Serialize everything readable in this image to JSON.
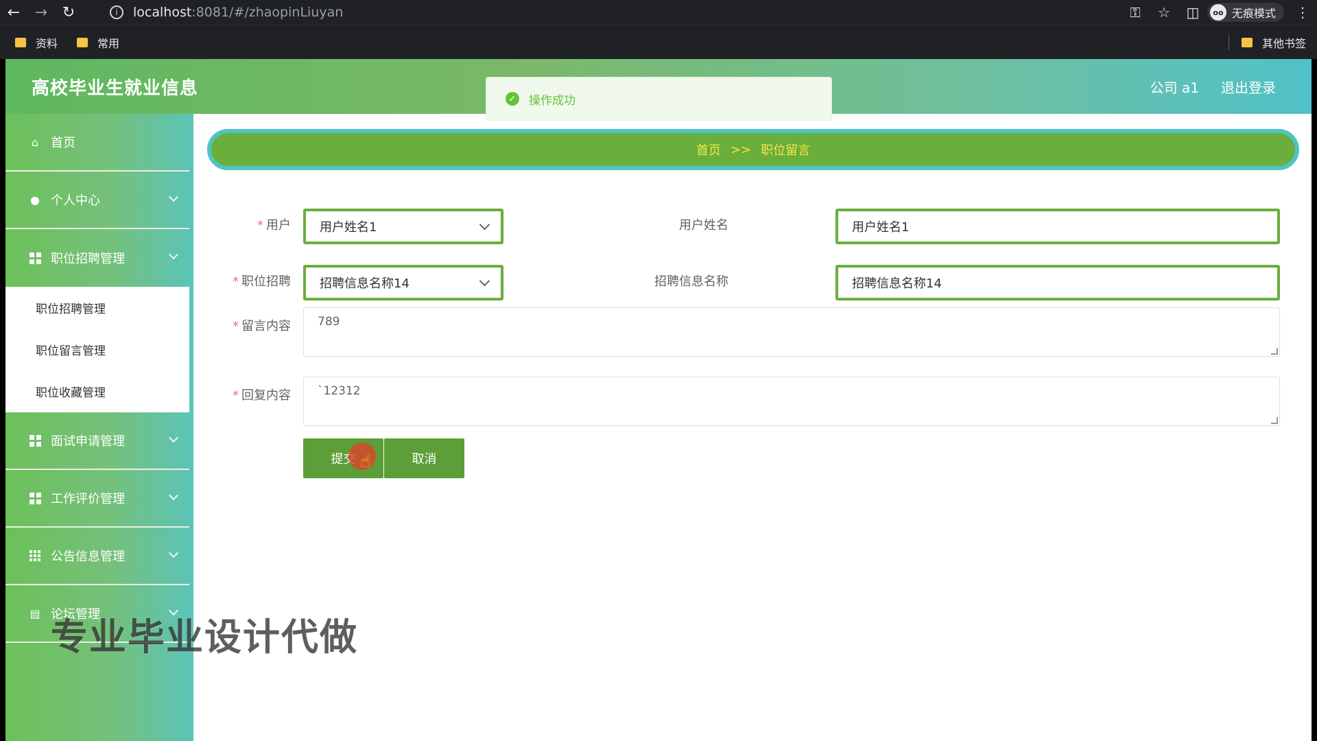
{
  "browser": {
    "url_host": "localhost",
    "url_rest": ":8081/#/zhaopinLiuyan",
    "incognito_label": "无痕模式",
    "bookmarks": [
      "资料",
      "常用"
    ],
    "other_bookmarks": "其他书签"
  },
  "header": {
    "title": "高校毕业生就业信息",
    "user": "公司 a1",
    "logout": "退出登录"
  },
  "toast": {
    "message": "操作成功"
  },
  "sidebar": {
    "home": "首页",
    "personal": "个人中心",
    "job_mgmt": "职位招聘管理",
    "sub_items": [
      "职位招聘管理",
      "职位留言管理",
      "职位收藏管理"
    ],
    "interview": "面试申请管理",
    "evaluation": "工作评价管理",
    "notice": "公告信息管理",
    "forum": "论坛管理"
  },
  "breadcrumb": {
    "home": "首页",
    "sep": ">>",
    "current": "职位留言"
  },
  "form": {
    "user_label": "用户",
    "user_value": "用户姓名1",
    "username_label": "用户姓名",
    "username_value": "用户姓名1",
    "job_label": "职位招聘",
    "job_value": "招聘信息名称14",
    "jobname_label": "招聘信息名称",
    "jobname_value": "招聘信息名称14",
    "message_label": "留言内容",
    "message_value": "789",
    "reply_label": "回复内容",
    "reply_value": "`12312",
    "submit": "提交",
    "cancel": "取消"
  },
  "watermark": "专业毕业设计代做"
}
